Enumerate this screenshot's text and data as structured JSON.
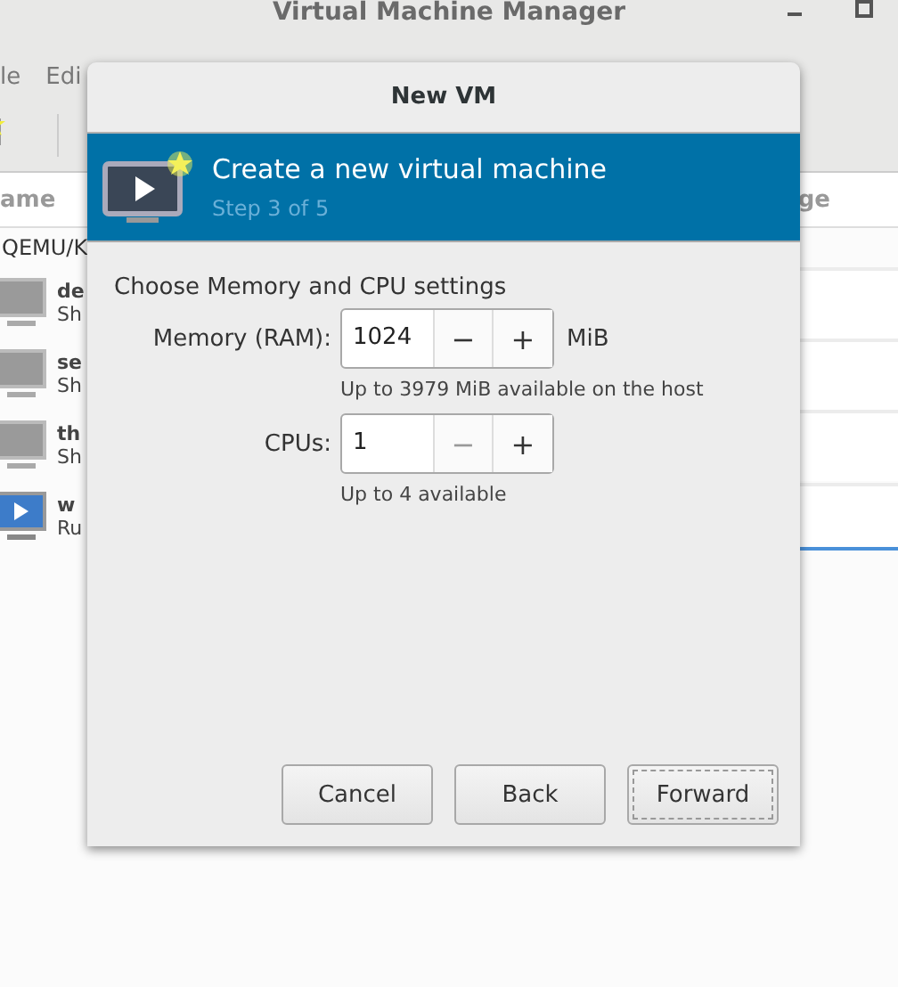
{
  "window": {
    "title": "Virtual Machine Manager"
  },
  "menu": [
    "le",
    "Edi"
  ],
  "table": {
    "columns": [
      "ame",
      "ge"
    ],
    "connection": "QEMU/K",
    "rows": [
      {
        "name": "de",
        "status": "Sh",
        "running": false,
        "selected": false
      },
      {
        "name": "se",
        "status": "Sh",
        "running": false,
        "selected": false
      },
      {
        "name": "th",
        "status": "Sh",
        "running": false,
        "selected": false
      },
      {
        "name": "w",
        "status": "Ru",
        "running": true,
        "selected": true
      }
    ]
  },
  "dialog": {
    "title": "New VM",
    "heading": "Create a new virtual machine",
    "step": "Step 3 of 5",
    "section": "Choose Memory and CPU settings",
    "fields": [
      {
        "label": "Memory (RAM):",
        "value": "1024",
        "unit": "MiB",
        "hint": "Up to 3979 MiB available on the host",
        "minus": "−",
        "plus": "+",
        "minus_disabled": false,
        "plus_disabled": false
      },
      {
        "label": "CPUs:",
        "value": "1",
        "hint": "Up to 4 available",
        "minus": "−",
        "plus": "+",
        "minus_disabled": true,
        "plus_disabled": false
      }
    ],
    "buttons": [
      {
        "label": "Cancel",
        "focused": false
      },
      {
        "label": "Back",
        "focused": false
      },
      {
        "label": "Forward",
        "focused": true
      }
    ]
  }
}
